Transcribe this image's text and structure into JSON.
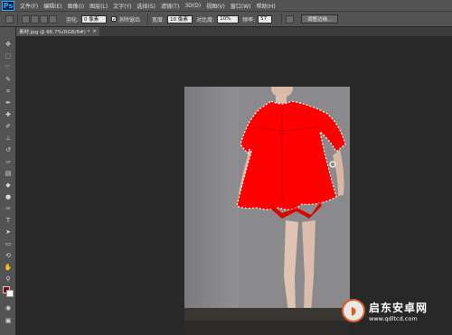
{
  "app": {
    "logo": "Ps"
  },
  "menu": [
    "文件(F)",
    "编辑(E)",
    "图像(I)",
    "图层(L)",
    "文字(Y)",
    "选择(S)",
    "滤镜(T)",
    "3D(D)",
    "视图(V)",
    "窗口(W)",
    "帮助(H)"
  ],
  "options": {
    "feather_label": "羽化:",
    "feather_value": "0 像素",
    "antialias_checked": true,
    "antialias_label": "消除锯齿",
    "width_label": "宽度:",
    "width_value": "10 像素",
    "contrast_label": "对比度:",
    "contrast_value": "10%",
    "frequency_label": "频率:",
    "frequency_value": "57",
    "refine_edge_label": "调整边缘..."
  },
  "document_tab": {
    "title": "素材.jpg @ 66.7%(RGB/8#) *",
    "close": "×"
  },
  "colors": {
    "foreground": "#7a1010",
    "background": "#ffffff",
    "selection_fill": "#ff0000",
    "watermark_accent": "#e05a1e"
  },
  "watermark": {
    "title": "启东安卓网",
    "url": "www.qdltcd.com"
  }
}
